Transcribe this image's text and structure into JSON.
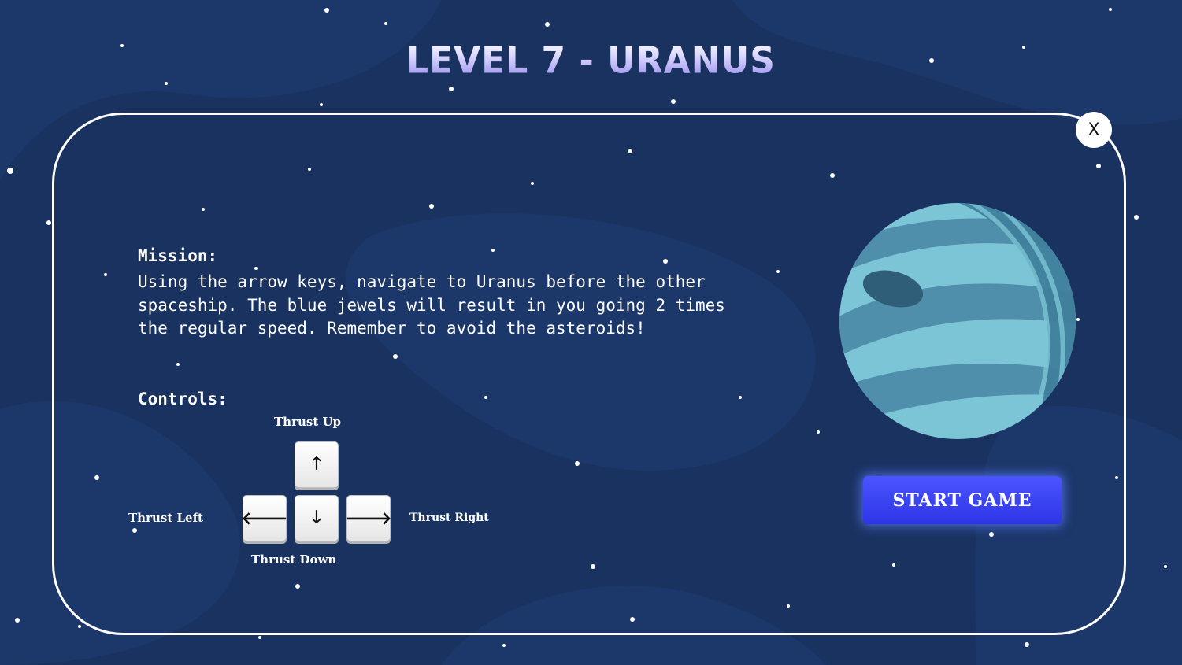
{
  "title": "LEVEL 7 - URANUS",
  "close_label": "X",
  "mission": {
    "heading": "Mission:",
    "text": "Using the arrow keys, navigate to Uranus before the other spaceship. The blue jewels will result in you going 2 times the regular speed. Remember to avoid the asteroids!"
  },
  "controls": {
    "heading": "Controls:",
    "up_label": "Thrust Up",
    "left_label": "Thrust Left",
    "right_label": "Thrust Right",
    "down_label": "Thrust Down",
    "keys": {
      "up": "🡑",
      "left": "🡐",
      "down": "🡓",
      "right": "🡒"
    }
  },
  "start_button": "START GAME",
  "colors": {
    "background": "#1a3260",
    "planet_light": "#7cc5d6",
    "planet_dark": "#3f7f9c",
    "start_button": "#3a42f2"
  }
}
